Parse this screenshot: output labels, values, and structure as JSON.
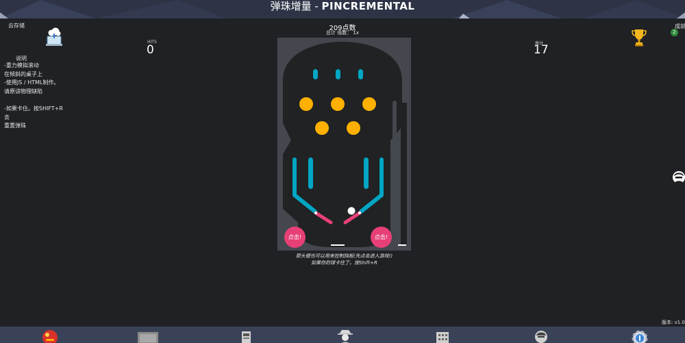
{
  "header": {
    "title_cn": "弹珠增量 - ",
    "title_en": "PINCREMENTAL"
  },
  "left": {
    "cloud_save_label": "云存储",
    "cloud_icon": "cloud-save-icon",
    "howto_title": "说明",
    "howto_lines": [
      "-重力模拟滚动",
      "在倾斜的桌子上",
      "-使用JS / HTML制作。",
      "请原谅物理缺陷",
      "",
      "-如果卡住。按SHIFT+R",
      "去",
      "重置弹珠"
    ]
  },
  "stats": {
    "hits_label": "HITS",
    "hits_value": "0",
    "points": "209点数",
    "multiplier": "总计 倍数：  1x",
    "high_label": "高分",
    "high_value": "17"
  },
  "right": {
    "achievements_label": "成就",
    "achievements_count": "2",
    "trophy_icon": "trophy-icon",
    "version": "版本: v1.08"
  },
  "table": {
    "tap_left": "点击!",
    "tap_right": "点击!",
    "note_line1": "箭头键也可以用来控制挡板(先点击进入游戏!)",
    "note_line2": "如果你的球卡住了。按Shift+R",
    "colors": {
      "board": "#44484e",
      "field": "#202224",
      "bumper": "#ffb000",
      "rail": "#00a6c4",
      "flipper": "#e74077",
      "ball": "#ffffff"
    }
  },
  "bottom_nav": [
    "pinball-icon",
    "ticket-icon",
    "machine-icon",
    "detective-icon",
    "building-icon",
    "agent-icon",
    "settings-icon"
  ]
}
